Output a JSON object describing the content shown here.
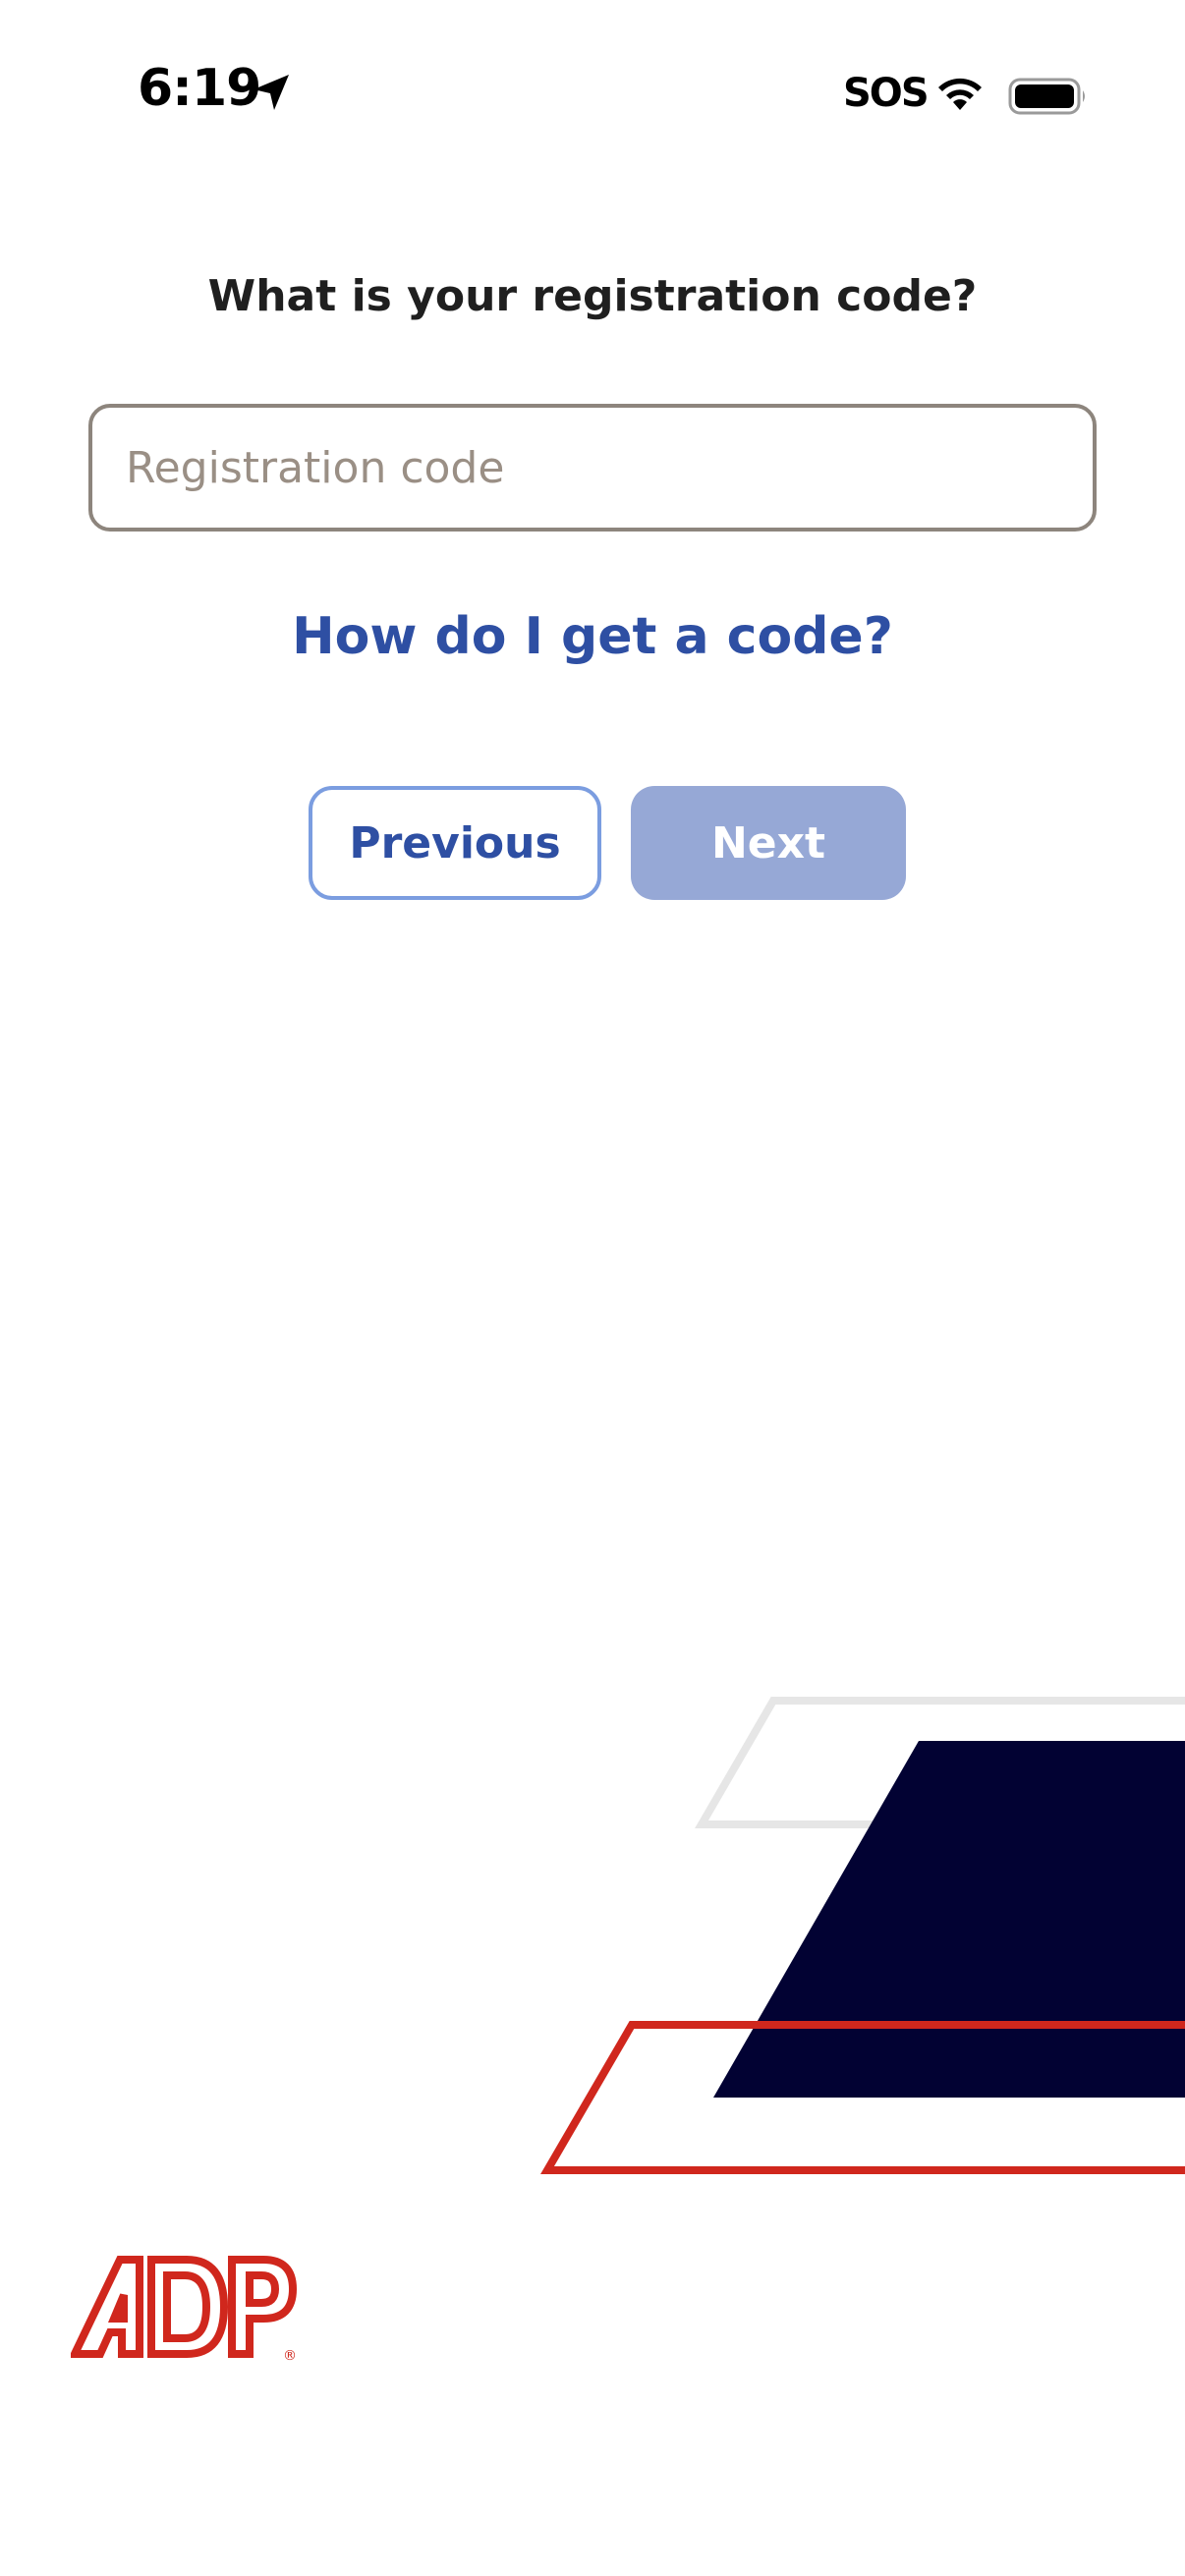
{
  "status_bar": {
    "time": "6:19",
    "sos": "SOS",
    "icons": [
      "location-arrow-icon",
      "wifi-icon",
      "battery-icon"
    ]
  },
  "registration": {
    "question": "What is your registration code?",
    "input_placeholder": "Registration code",
    "input_value": "",
    "help_link": "How do I get a code?"
  },
  "buttons": {
    "previous_label": "Previous",
    "next_label": "Next",
    "next_enabled": false
  },
  "branding": {
    "logo_text": "ADP",
    "registered_mark": "®"
  },
  "colors": {
    "link_blue": "#2e4fa3",
    "previous_border": "#7b9de0",
    "next_disabled": "#96a8d6",
    "input_border": "#8d857d",
    "brand_red": "#d0271d",
    "navy": "#020233",
    "light_gray": "#e6e6e6"
  }
}
